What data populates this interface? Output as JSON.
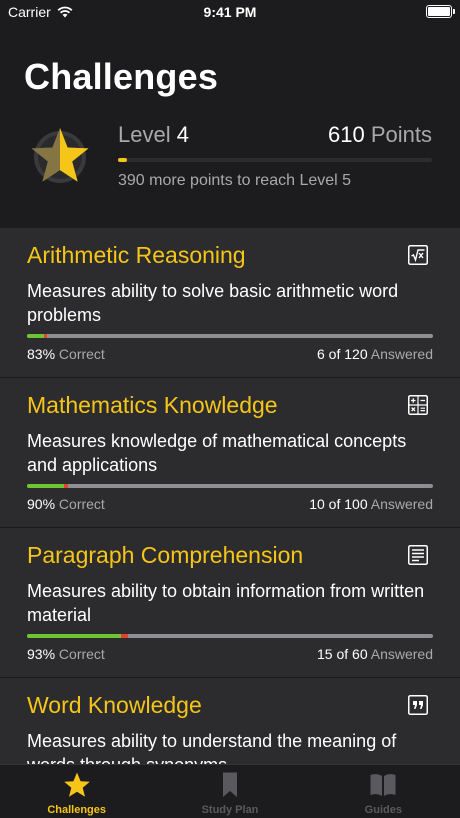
{
  "status_bar": {
    "carrier": "Carrier",
    "time": "9:41 PM"
  },
  "header": {
    "title": "Challenges",
    "level_word": "Level",
    "level_number": "4",
    "points_number": "610",
    "points_word": "Points",
    "level_progress_fraction": 0.03,
    "note": "390 more points to reach Level 5"
  },
  "challenges": [
    {
      "title": "Arithmetic Reasoning",
      "icon": "square-root-icon",
      "description": "Measures ability to solve basic arithmetic word problems",
      "correct_percent": "83%",
      "correct_word": "Correct",
      "answered_count": "6 of 120",
      "answered_word": "Answered",
      "answered_fraction": 0.05,
      "correct_fraction": 0.83
    },
    {
      "title": "Mathematics Knowledge",
      "icon": "calculator-icon",
      "description": "Measures knowledge of mathematical concepts and applications",
      "correct_percent": "90%",
      "correct_word": "Correct",
      "answered_count": "10 of 100",
      "answered_word": "Answered",
      "answered_fraction": 0.1,
      "correct_fraction": 0.9
    },
    {
      "title": "Paragraph Comprehension",
      "icon": "document-icon",
      "description": "Measures ability to obtain information from written material",
      "correct_percent": "93%",
      "correct_word": "Correct",
      "answered_count": "15 of 60",
      "answered_word": "Answered",
      "answered_fraction": 0.25,
      "correct_fraction": 0.93
    },
    {
      "title": "Word Knowledge",
      "icon": "quote-icon",
      "description": "Measures ability to understand the meaning of words through synonyms"
    }
  ],
  "tabs": [
    {
      "label": "Challenges",
      "icon": "star-icon",
      "active": true
    },
    {
      "label": "Study Plan",
      "icon": "bookmark-icon",
      "active": false
    },
    {
      "label": "Guides",
      "icon": "book-icon",
      "active": false
    }
  ],
  "colors": {
    "accent": "#f5c518",
    "correct": "#6ec531",
    "wrong": "#e0452c",
    "background": "#1c1c1e",
    "card": "#2c2c2e"
  }
}
